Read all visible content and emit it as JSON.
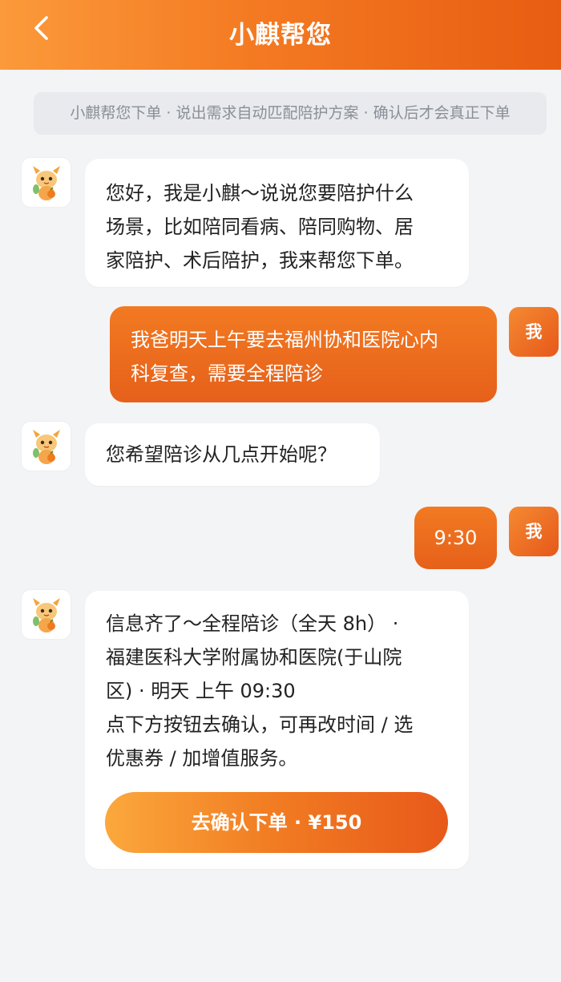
{
  "header": {
    "title": "小麒帮您",
    "back_icon": "chevron-left-icon"
  },
  "notice": {
    "text": "小麒帮您下单 · 说出需求自动匹配陪护方案 · 确认后才会真正下单"
  },
  "user": {
    "avatar_label": "我"
  },
  "messages": [
    {
      "role": "bot",
      "lines": [
        "您好，我是小麒～说说您要陪护什么",
        "场景，比如陪同看病、陪同购物、居",
        "家陪护、术后陪护，我来帮您下单。"
      ]
    },
    {
      "role": "user",
      "lines": [
        "我爸明天上午要去福州协和医院心内",
        "科复查，需要全程陪诊"
      ]
    },
    {
      "role": "bot",
      "lines": [
        "您希望陪诊从几点开始呢？"
      ]
    },
    {
      "role": "user",
      "lines": [
        "9:30"
      ]
    },
    {
      "role": "bot",
      "lines": [
        "信息齐了～全程陪诊（全天 8h） ·",
        "福建医科大学附属协和医院(于山院",
        "区) · 明天 上午 09:30",
        "点下方按钮去确认，可再改时间 / 选",
        "优惠券 / 加增值服务。"
      ],
      "button": "去确认下单 · ¥150"
    }
  ],
  "colors": {
    "accent": "#f27a22",
    "accent_dark": "#e6581a",
    "background": "#f3f4f6"
  }
}
